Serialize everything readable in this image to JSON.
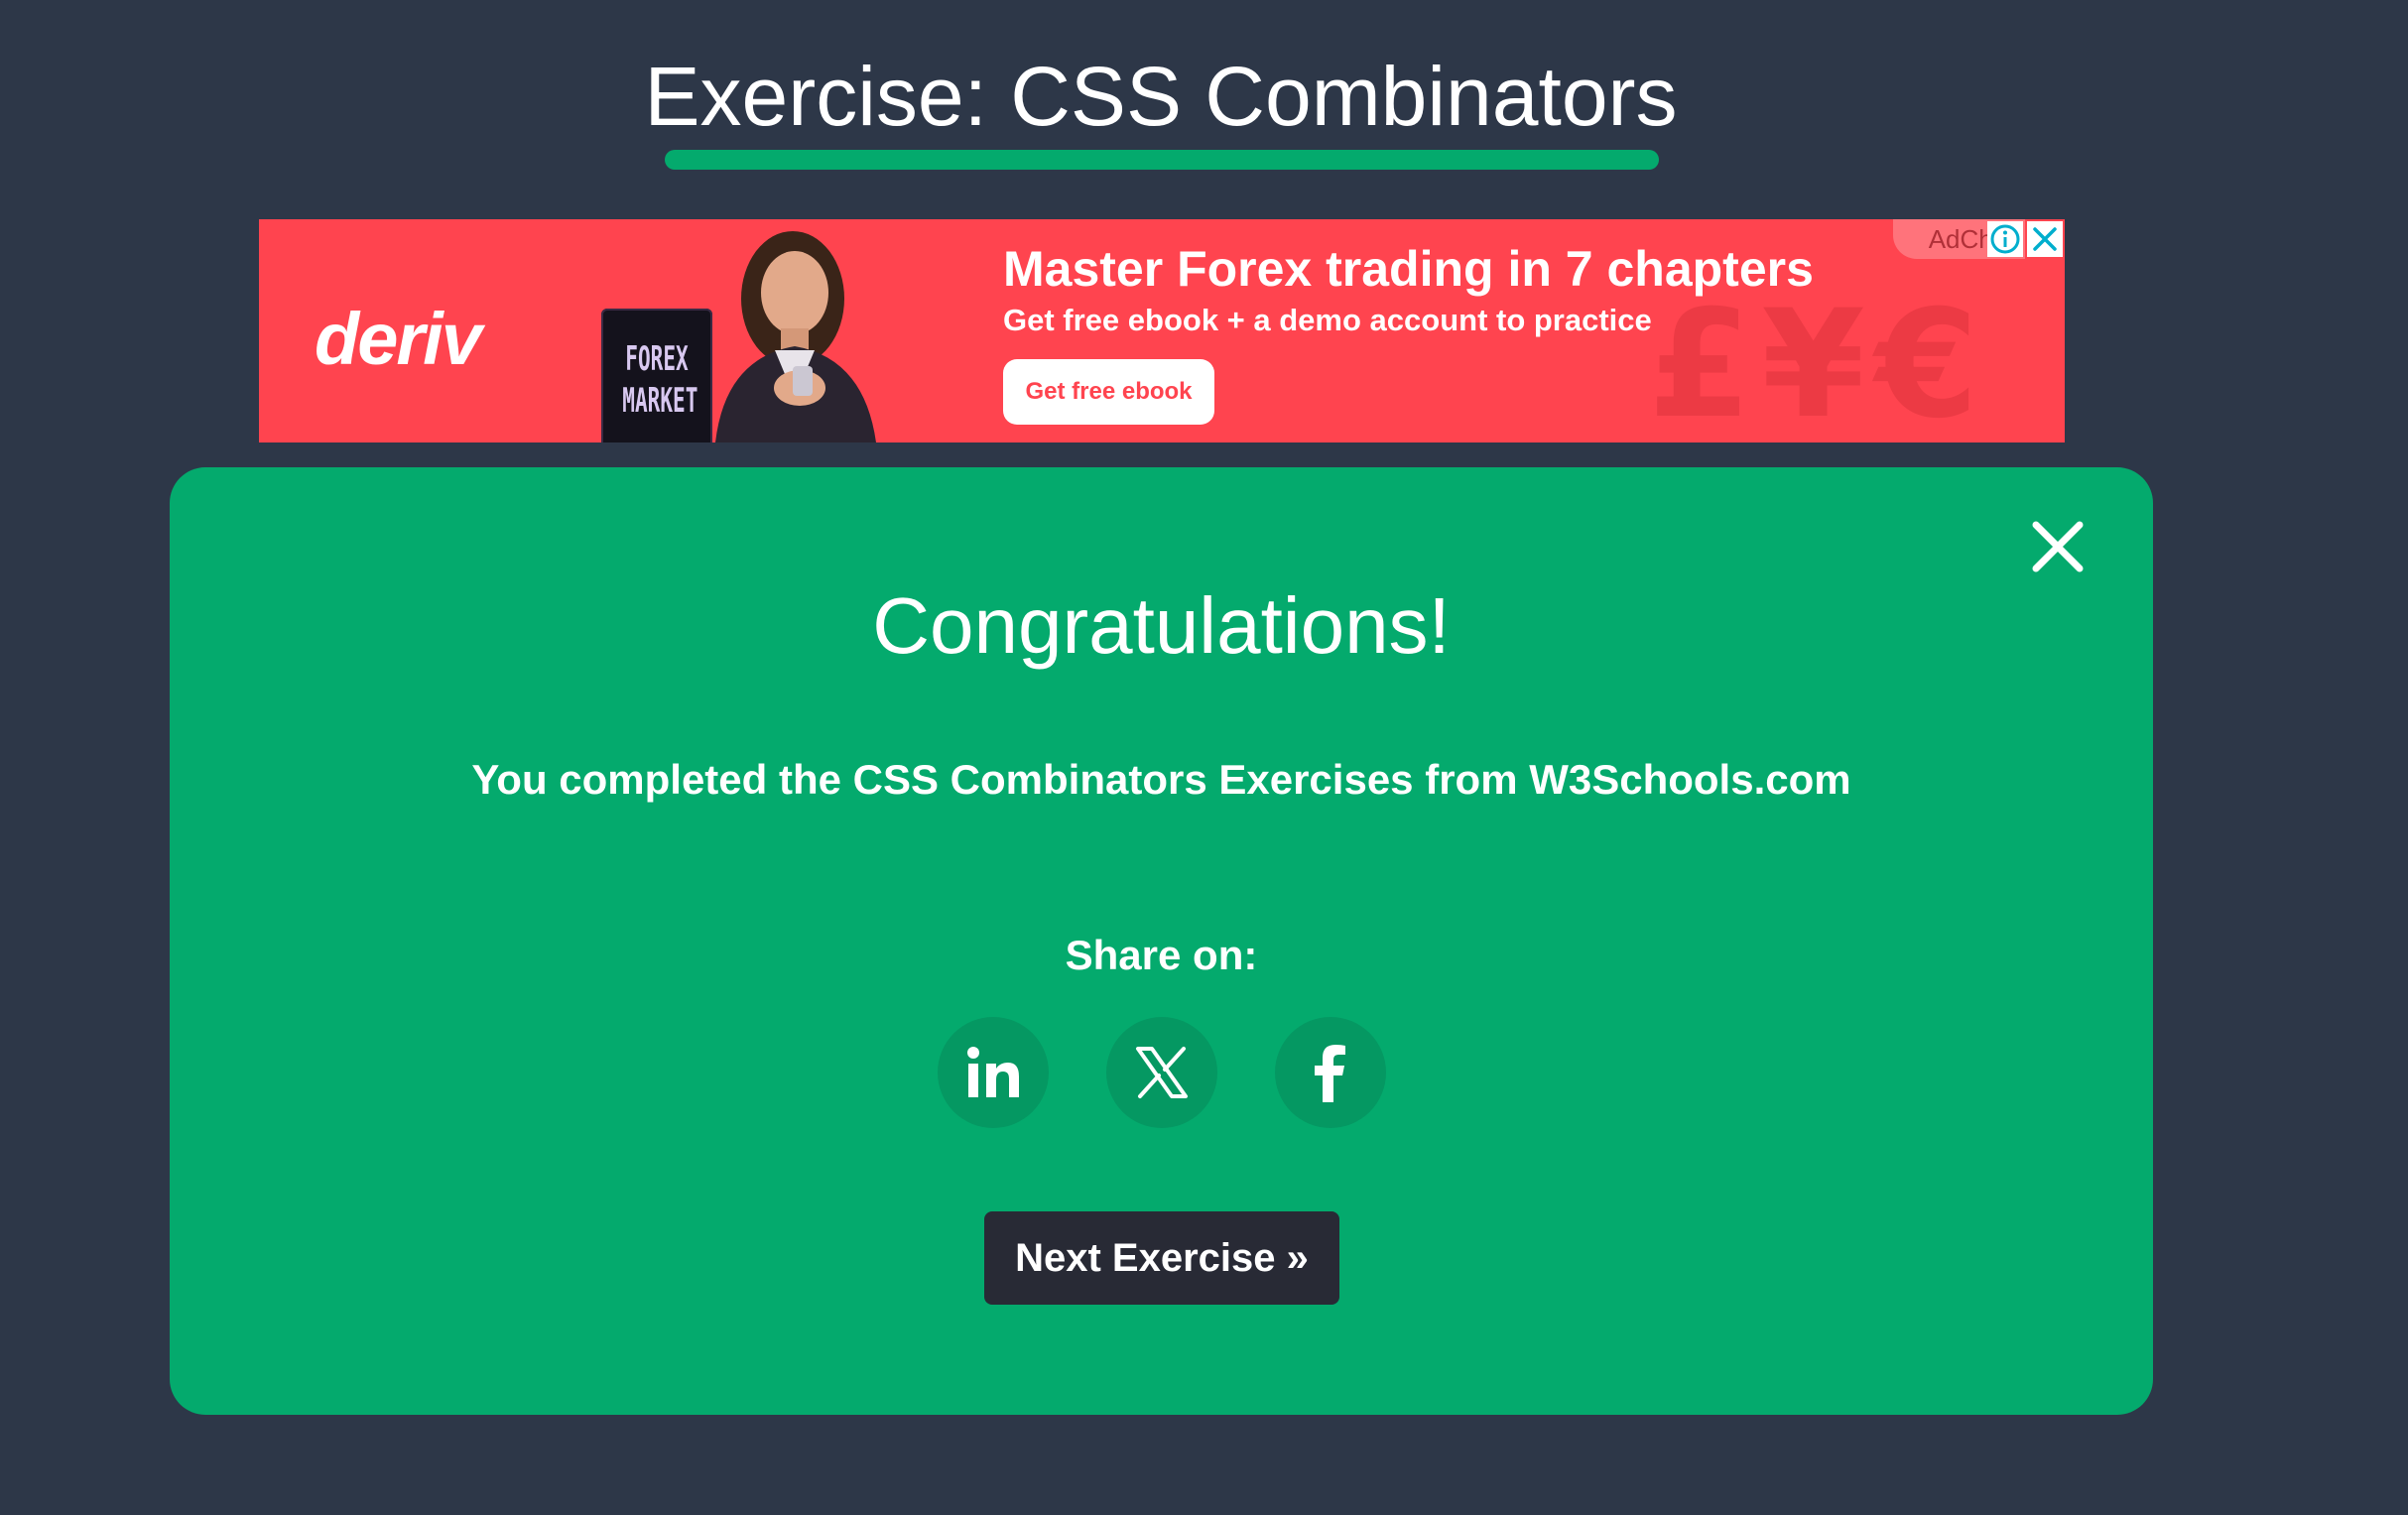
{
  "page": {
    "title": "Exercise: CSS Combinators",
    "accent_color": "#04aa6d",
    "background_color": "#2d3748"
  },
  "ad": {
    "brand": "deriv",
    "book_text": "FOREX MARKET",
    "headline": "Master Forex trading in 7 chapters",
    "subtext": "Get free ebook + a demo account to practice",
    "cta_label": "Get free ebook",
    "adchoices_label": "AdChoi",
    "info_icon": "info-icon",
    "close_icon": "close-icon",
    "background_color": "#ff444f",
    "bg_glyphs": "£¥€"
  },
  "modal": {
    "title": "Congratulations!",
    "message": "You completed the CSS Combinators Exercises from W3Schools.com",
    "share_label": "Share on:",
    "share_buttons": [
      {
        "network": "linkedin",
        "icon": "linkedin-icon",
        "glyph": "in"
      },
      {
        "network": "x",
        "icon": "x-icon",
        "glyph": "𝕏"
      },
      {
        "network": "facebook",
        "icon": "facebook-icon",
        "glyph": "f"
      }
    ],
    "next_label": "Next Exercise »",
    "close_icon": "close-icon",
    "background_color": "#04aa6d",
    "button_color": "#282a35"
  }
}
